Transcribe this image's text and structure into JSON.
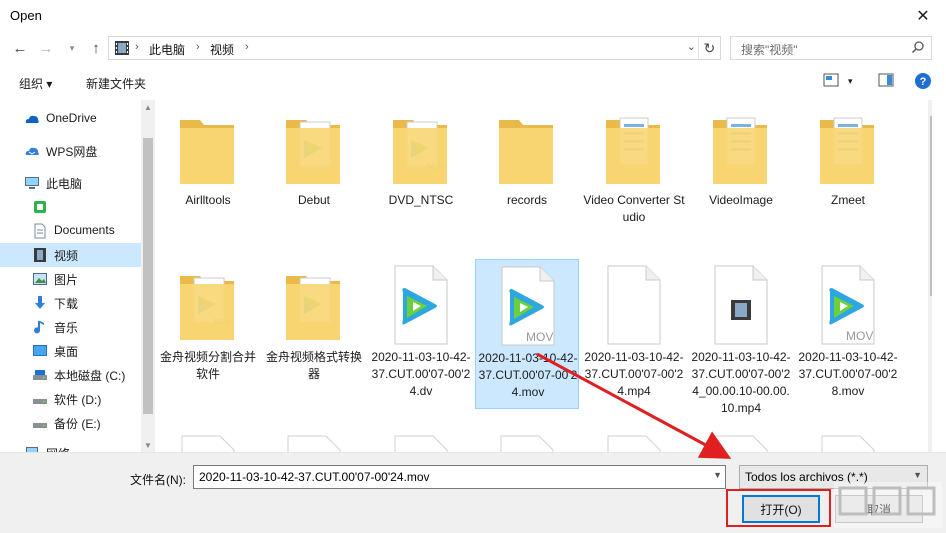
{
  "window": {
    "title": "Open"
  },
  "address": {
    "crumbs": [
      "此电脑",
      "视频"
    ],
    "search_placeholder": "搜索\"视频\""
  },
  "toolbar": {
    "organize": "组织 ▾",
    "new_folder": "新建文件夹"
  },
  "sidebar": {
    "items": [
      {
        "label": "OneDrive",
        "icon": "cloud-icon"
      },
      {
        "label": "WPS网盘",
        "icon": "wps-cloud-icon"
      },
      {
        "label": "此电脑",
        "icon": "computer-icon"
      },
      {
        "label": "",
        "icon": "green-app-icon"
      },
      {
        "label": "Documents",
        "icon": "document-icon"
      },
      {
        "label": "视频",
        "icon": "video-folder-icon"
      },
      {
        "label": "图片",
        "icon": "picture-folder-icon"
      },
      {
        "label": "下载",
        "icon": "download-icon"
      },
      {
        "label": "音乐",
        "icon": "music-icon"
      },
      {
        "label": "桌面",
        "icon": "desktop-icon"
      },
      {
        "label": "本地磁盘 (C:)",
        "icon": "drive-icon"
      },
      {
        "label": "软件 (D:)",
        "icon": "drive-icon"
      },
      {
        "label": "备份 (E:)",
        "icon": "drive-icon"
      },
      {
        "label": "网络",
        "icon": "network-icon"
      }
    ]
  },
  "files": [
    {
      "name": "Airlltools",
      "type": "folder"
    },
    {
      "name": "Debut",
      "type": "folder-video"
    },
    {
      "name": "DVD_NTSC",
      "type": "folder-mov"
    },
    {
      "name": "records",
      "type": "folder"
    },
    {
      "name": "Video Converter Studio",
      "type": "folder-docs"
    },
    {
      "name": "VideoImage",
      "type": "folder-docs"
    },
    {
      "name": "Zmeet",
      "type": "folder-docs"
    },
    {
      "name": "金舟视频分割合并软件",
      "type": "folder-mp4"
    },
    {
      "name": "金舟视频格式转换器",
      "type": "folder-video"
    },
    {
      "name": "2020-11-03-10-42-37.CUT.00'07-00'24.dv",
      "type": "video-file"
    },
    {
      "name": "2020-11-03-10-42-37.CUT.00'07-00'24.mov",
      "type": "mov-file"
    },
    {
      "name": "2020-11-03-10-42-37.CUT.00'07-00'24.mp4",
      "type": "blank-file"
    },
    {
      "name": "2020-11-03-10-42-37.CUT.00'07-00'24_00.00.10-00.00.10.mp4",
      "type": "film-file"
    },
    {
      "name": "2020-11-03-10-42-37.CUT.00'07-00'28.mov",
      "type": "mov-file"
    }
  ],
  "selected_file_index": 10,
  "bottom": {
    "filename_label": "文件名(N):",
    "filename_value": "2020-11-03-10-42-37.CUT.00'07-00'24.mov",
    "filetype_value": "Todos los archivos (*.*)",
    "open_label": "打开(O)",
    "cancel_label": "取消"
  },
  "colors": {
    "selection": "#cce8ff",
    "accent": "#0078d7",
    "annotation": "#e02020",
    "folder": "#f8d775"
  }
}
